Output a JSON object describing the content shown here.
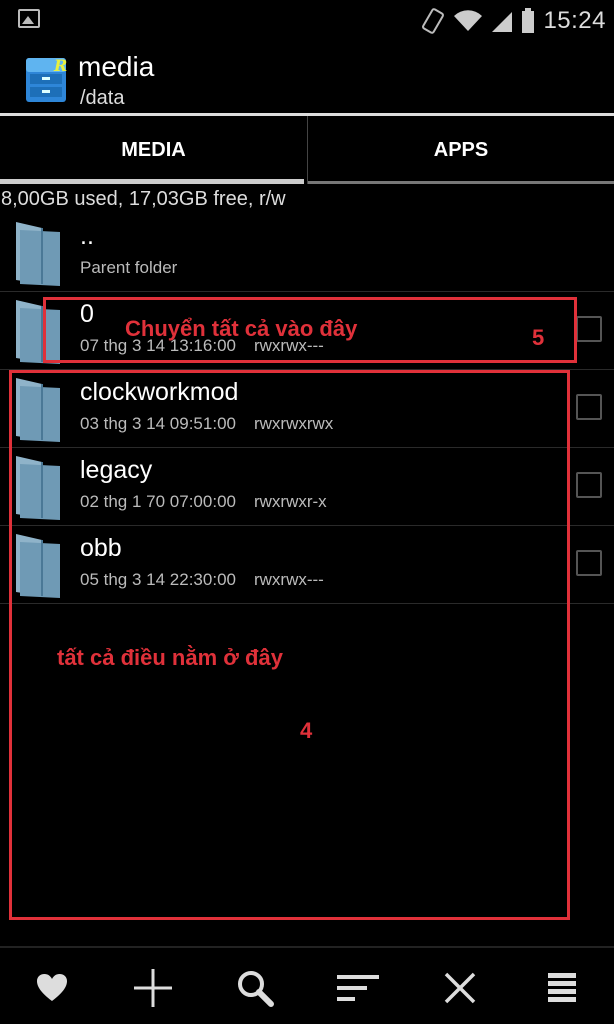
{
  "status_bar": {
    "time": "15:24"
  },
  "app": {
    "title": "media",
    "path": "/data"
  },
  "tabs": [
    {
      "label": "MEDIA",
      "active": true
    },
    {
      "label": "APPS",
      "active": false
    }
  ],
  "storage_info": "8,00GB used, 17,03GB free, r/w",
  "files": [
    {
      "name": "..",
      "meta": "Parent folder",
      "permissions": ""
    },
    {
      "name": "0",
      "meta": "07 thg 3 14 13:16:00",
      "permissions": "rwxrwx---"
    },
    {
      "name": "clockworkmod",
      "meta": "03 thg 3 14 09:51:00",
      "permissions": "rwxrwxrwx"
    },
    {
      "name": "legacy",
      "meta": "02 thg 1 70 07:00:00",
      "permissions": "rwxrwxr-x"
    },
    {
      "name": "obb",
      "meta": "05 thg 3 14 22:30:00",
      "permissions": "rwxrwx---"
    }
  ],
  "annotations": {
    "move_here": "Chuyển tất cả vào đây",
    "move_here_number": "5",
    "all_here": "tất cả điều nằm ở đây",
    "all_here_number": "4",
    "color": "#e0313a"
  },
  "toolbar_icons": [
    "heart-icon",
    "plus-icon",
    "search-icon",
    "sort-icon",
    "close-icon",
    "menu-icon"
  ]
}
